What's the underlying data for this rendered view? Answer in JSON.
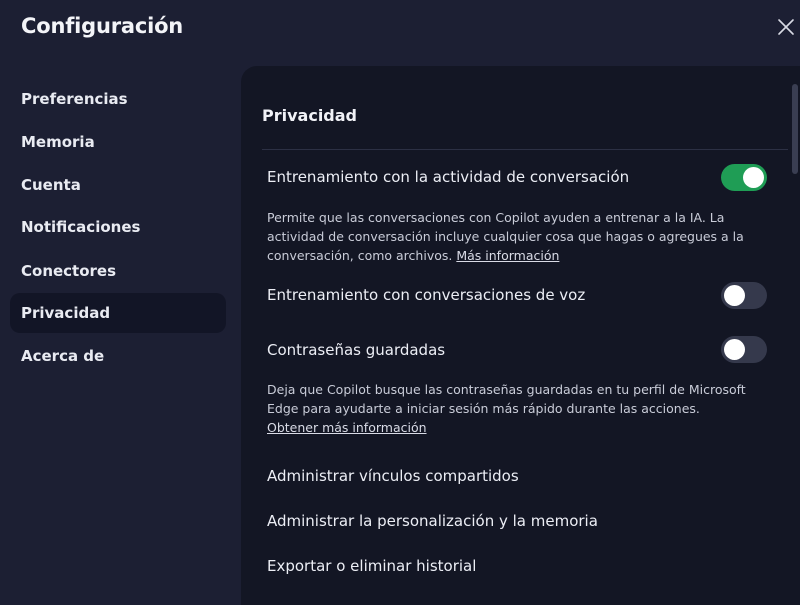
{
  "dialog": {
    "title": "Configuración",
    "close_icon": "close-icon"
  },
  "sidebar": {
    "items": [
      {
        "label": "Preferencias",
        "active": false
      },
      {
        "label": "Memoria",
        "active": false
      },
      {
        "label": "Cuenta",
        "active": false
      },
      {
        "label": "Notificaciones",
        "active": false
      },
      {
        "label": "Conectores",
        "active": false
      },
      {
        "label": "Privacidad",
        "active": true
      },
      {
        "label": "Acerca de",
        "active": false
      }
    ]
  },
  "privacy": {
    "section_title": "Privacidad",
    "training_activity": {
      "label": "Entrenamiento con la actividad de conversación",
      "enabled": true,
      "description": "Permite que las conversaciones con Copilot ayuden a entrenar a la IA. La actividad de conversación incluye cualquier cosa que hagas o agregues a la conversación, como archivos.",
      "link": "Más información"
    },
    "voice_training": {
      "label": "Entrenamiento con conversaciones de voz",
      "enabled": false
    },
    "saved_passwords": {
      "label": "Contraseñas guardadas",
      "enabled": false,
      "description": "Deja que Copilot busque las contraseñas guardadas en tu perfil de Microsoft Edge para ayudarte a iniciar sesión más rápido durante las acciones.",
      "link": "Obtener más información"
    },
    "actions": [
      "Administrar vínculos compartidos",
      "Administrar la personalización y la memoria",
      "Exportar o eliminar historial"
    ]
  },
  "colors": {
    "background": "#1c1f33",
    "panel": "#131624",
    "toggle_on": "#1f9d55",
    "toggle_off": "#35394c"
  }
}
